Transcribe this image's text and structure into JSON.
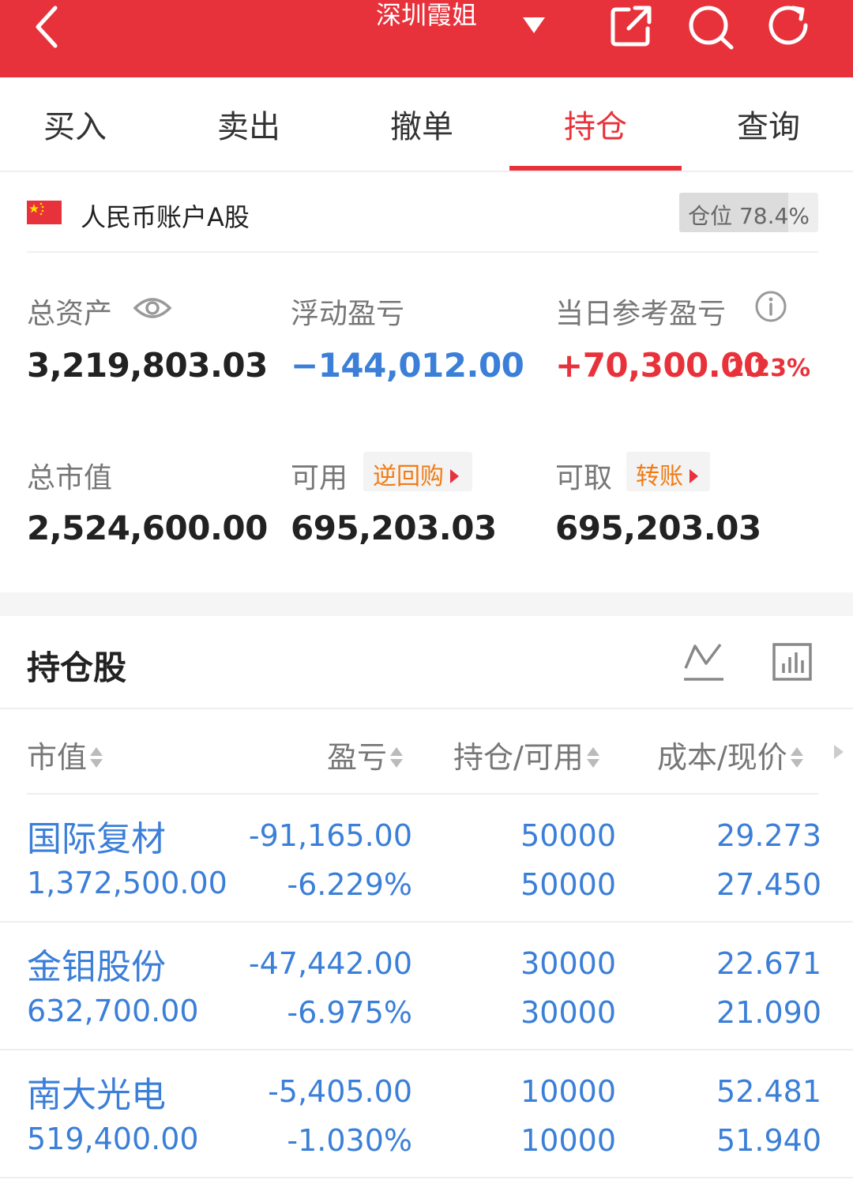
{
  "header": {
    "title": "深圳霞姐",
    "icons": [
      "back-icon",
      "dropdown-caret-icon",
      "share-icon",
      "search-icon",
      "refresh-icon"
    ]
  },
  "tabs": [
    {
      "label": "买入"
    },
    {
      "label": "卖出"
    },
    {
      "label": "撤单"
    },
    {
      "label": "持仓",
      "active": true
    },
    {
      "label": "查询"
    }
  ],
  "account": {
    "name": "人民币账户A股",
    "position_label": "仓位",
    "position_value": "78.4%",
    "position_fraction": 0.784
  },
  "stats": {
    "total_assets": {
      "label": "总资产",
      "value": "3,219,803.03"
    },
    "floating_pl": {
      "label": "浮动盈亏",
      "value": "−144,012.00"
    },
    "daily_pl": {
      "label": "当日参考盈亏",
      "value": "+70,300.00",
      "percent": "2.23%"
    },
    "market_value": {
      "label": "总市值",
      "value": "2,524,600.00"
    },
    "available": {
      "label": "可用",
      "value": "695,203.03",
      "chip": "逆回购"
    },
    "withdrawable": {
      "label": "可取",
      "value": "695,203.03",
      "chip": "转账"
    }
  },
  "holdings": {
    "title": "持仓股",
    "columns": [
      "市值",
      "盈亏",
      "持仓/可用",
      "成本/现价"
    ],
    "rows": [
      {
        "name": "国际复材",
        "market_value": "1,372,500.00",
        "pl": "-91,165.00",
        "pl_pct": "-6.229%",
        "holding": "50000",
        "available": "50000",
        "cost": "29.273",
        "price": "27.450"
      },
      {
        "name": "金钼股份",
        "market_value": "632,700.00",
        "pl": "-47,442.00",
        "pl_pct": "-6.975%",
        "holding": "30000",
        "available": "30000",
        "cost": "22.671",
        "price": "21.090"
      },
      {
        "name": "南大光电",
        "market_value": "519,400.00",
        "pl": "-5,405.00",
        "pl_pct": "-1.030%",
        "holding": "10000",
        "available": "10000",
        "cost": "52.481",
        "price": "51.940"
      }
    ]
  },
  "colors": {
    "brand_red": "#e8323b",
    "loss_blue": "#3b7fd8",
    "chip_orange": "#f07c16"
  }
}
